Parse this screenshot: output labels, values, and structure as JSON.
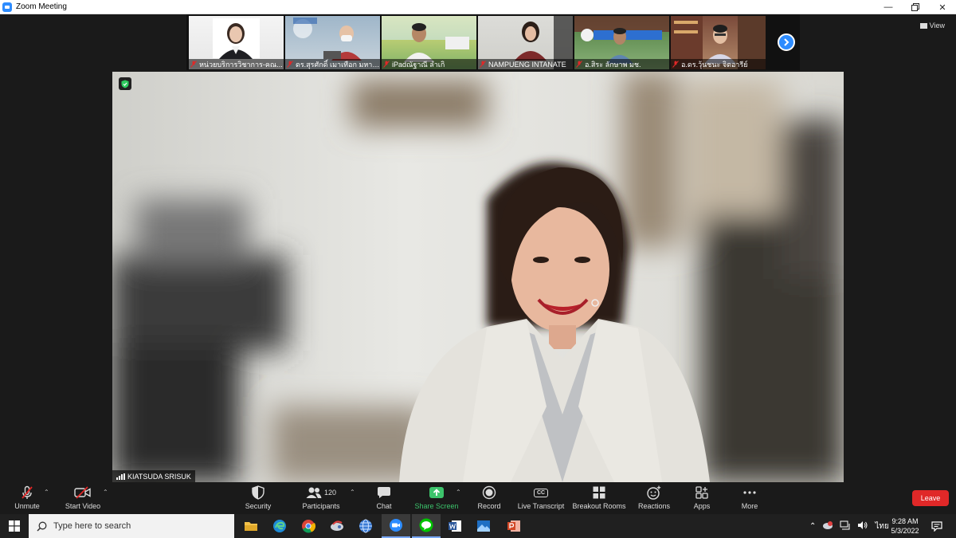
{
  "window": {
    "title": "Zoom Meeting",
    "controls": [
      "minimize-icon",
      "restore-icon",
      "close-icon"
    ]
  },
  "view_label": "View",
  "participant_strip": [
    {
      "name": "หน่วยบริการวิชาการ-คณ...",
      "muted": true
    },
    {
      "name": "ดร.สุรศักดิ์ เมาเทือก มหาวิท...",
      "muted": true
    },
    {
      "name": "iPadณัฐาณี ลำเกิ",
      "muted": true
    },
    {
      "name": "NAMPUENG INTANATE",
      "muted": true
    },
    {
      "name": "อ.สิระ ลักษาพ มช.",
      "muted": true
    },
    {
      "name": "อ.ดร.วุ้นชนะ จิตอารีย์",
      "muted": true
    }
  ],
  "active_speaker": {
    "name": "KIATSUDA SRISUK"
  },
  "toolbar": {
    "unmute": "Unmute",
    "start_video": "Start Video",
    "security": "Security",
    "participants": "Participants",
    "participants_count": "120",
    "chat": "Chat",
    "share_screen": "Share Screen",
    "record": "Record",
    "live_transcript": "Live Transcript",
    "breakout_rooms": "Breakout Rooms",
    "reactions": "Reactions",
    "apps": "Apps",
    "more": "More",
    "leave": "Leave",
    "cc_badge": "CC"
  },
  "taskbar": {
    "search_placeholder": "Type here to search",
    "apps": [
      "file-explorer-icon",
      "edge-icon",
      "chrome-icon",
      "app-icon",
      "globe-icon",
      "zoom-icon",
      "line-icon",
      "word-icon",
      "photos-icon",
      "powerpoint-icon"
    ],
    "active_app": "line-icon",
    "language": "ไทย",
    "time": "9:28 AM",
    "date": "5/3/2022"
  },
  "colors": {
    "zoom_blue": "#2d8cff",
    "share_green": "#3cc36b",
    "leave_red": "#e02828",
    "toolbar_bg": "#1a1a1a"
  }
}
